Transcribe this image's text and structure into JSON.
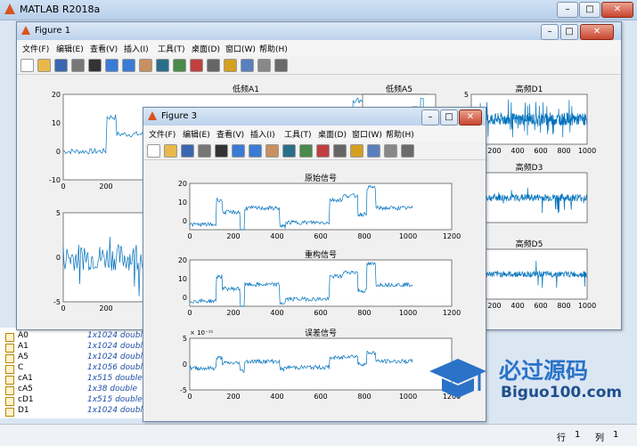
{
  "main": {
    "title": "MATLAB R2018a"
  },
  "workspace": [
    {
      "name": "A0",
      "value": "1x1024 double"
    },
    {
      "name": "A1",
      "value": "1x1024 double"
    },
    {
      "name": "A5",
      "value": "1x1024 double"
    },
    {
      "name": "C",
      "value": "1x1056 double"
    },
    {
      "name": "cA1",
      "value": "1x515 double"
    },
    {
      "name": "cA5",
      "value": "1x38 double"
    },
    {
      "name": "cD1",
      "value": "1x515 double"
    },
    {
      "name": "D1",
      "value": "1x1024 double"
    }
  ],
  "status": {
    "row_label": "行",
    "row": "1",
    "col_label": "列",
    "col": "1"
  },
  "menu": [
    "文件(F)",
    "编辑(E)",
    "查看(V)",
    "插入(I)",
    "工具(T)",
    "桌面(D)",
    "窗口(W)",
    "帮助(H)"
  ],
  "figure1": {
    "title": "Figure 1",
    "ax1": {
      "title": "低频A1",
      "yticks": [
        "20",
        "10",
        "0",
        "-10"
      ],
      "xticks": [
        "0",
        "200"
      ]
    },
    "ax2": {
      "yticks": [
        "5",
        "0",
        "-5"
      ],
      "xticks": [
        "0",
        "200"
      ]
    },
    "ax3": {
      "title": "低频A5"
    },
    "ax4": {
      "title": "高频D1",
      "yticks": [
        "5",
        "0",
        "-5"
      ],
      "xticks": [
        "0",
        "200",
        "400",
        "600",
        "800",
        "1000"
      ]
    },
    "ax5": {
      "title": "高频D3"
    },
    "ax6": {
      "title": "高频D5",
      "xticks": [
        "0",
        "200",
        "400",
        "600",
        "800",
        "1000"
      ]
    }
  },
  "figure3": {
    "title": "Figure 3",
    "ax1": {
      "title": "原始信号",
      "yticks": [
        "20",
        "10",
        "0"
      ],
      "xticks": [
        "0",
        "200",
        "400",
        "600",
        "800",
        "1000",
        "1200"
      ]
    },
    "ax2": {
      "title": "重构信号",
      "yticks": [
        "20",
        "10",
        "0"
      ],
      "xticks": [
        "0",
        "200",
        "400",
        "600",
        "800",
        "1000",
        "1200"
      ]
    },
    "ax3": {
      "title": "误差信号",
      "exponent": "× 10⁻¹¹",
      "yticks": [
        "5",
        "0",
        "-5"
      ],
      "xticks": [
        "0",
        "200",
        "400",
        "600",
        "800",
        "1000",
        "1200"
      ]
    }
  },
  "watermark": {
    "brand": "必过源码",
    "url": "Biguo100.com"
  },
  "colors": {
    "line": "#0072bd",
    "accent": "#2a72c8"
  }
}
